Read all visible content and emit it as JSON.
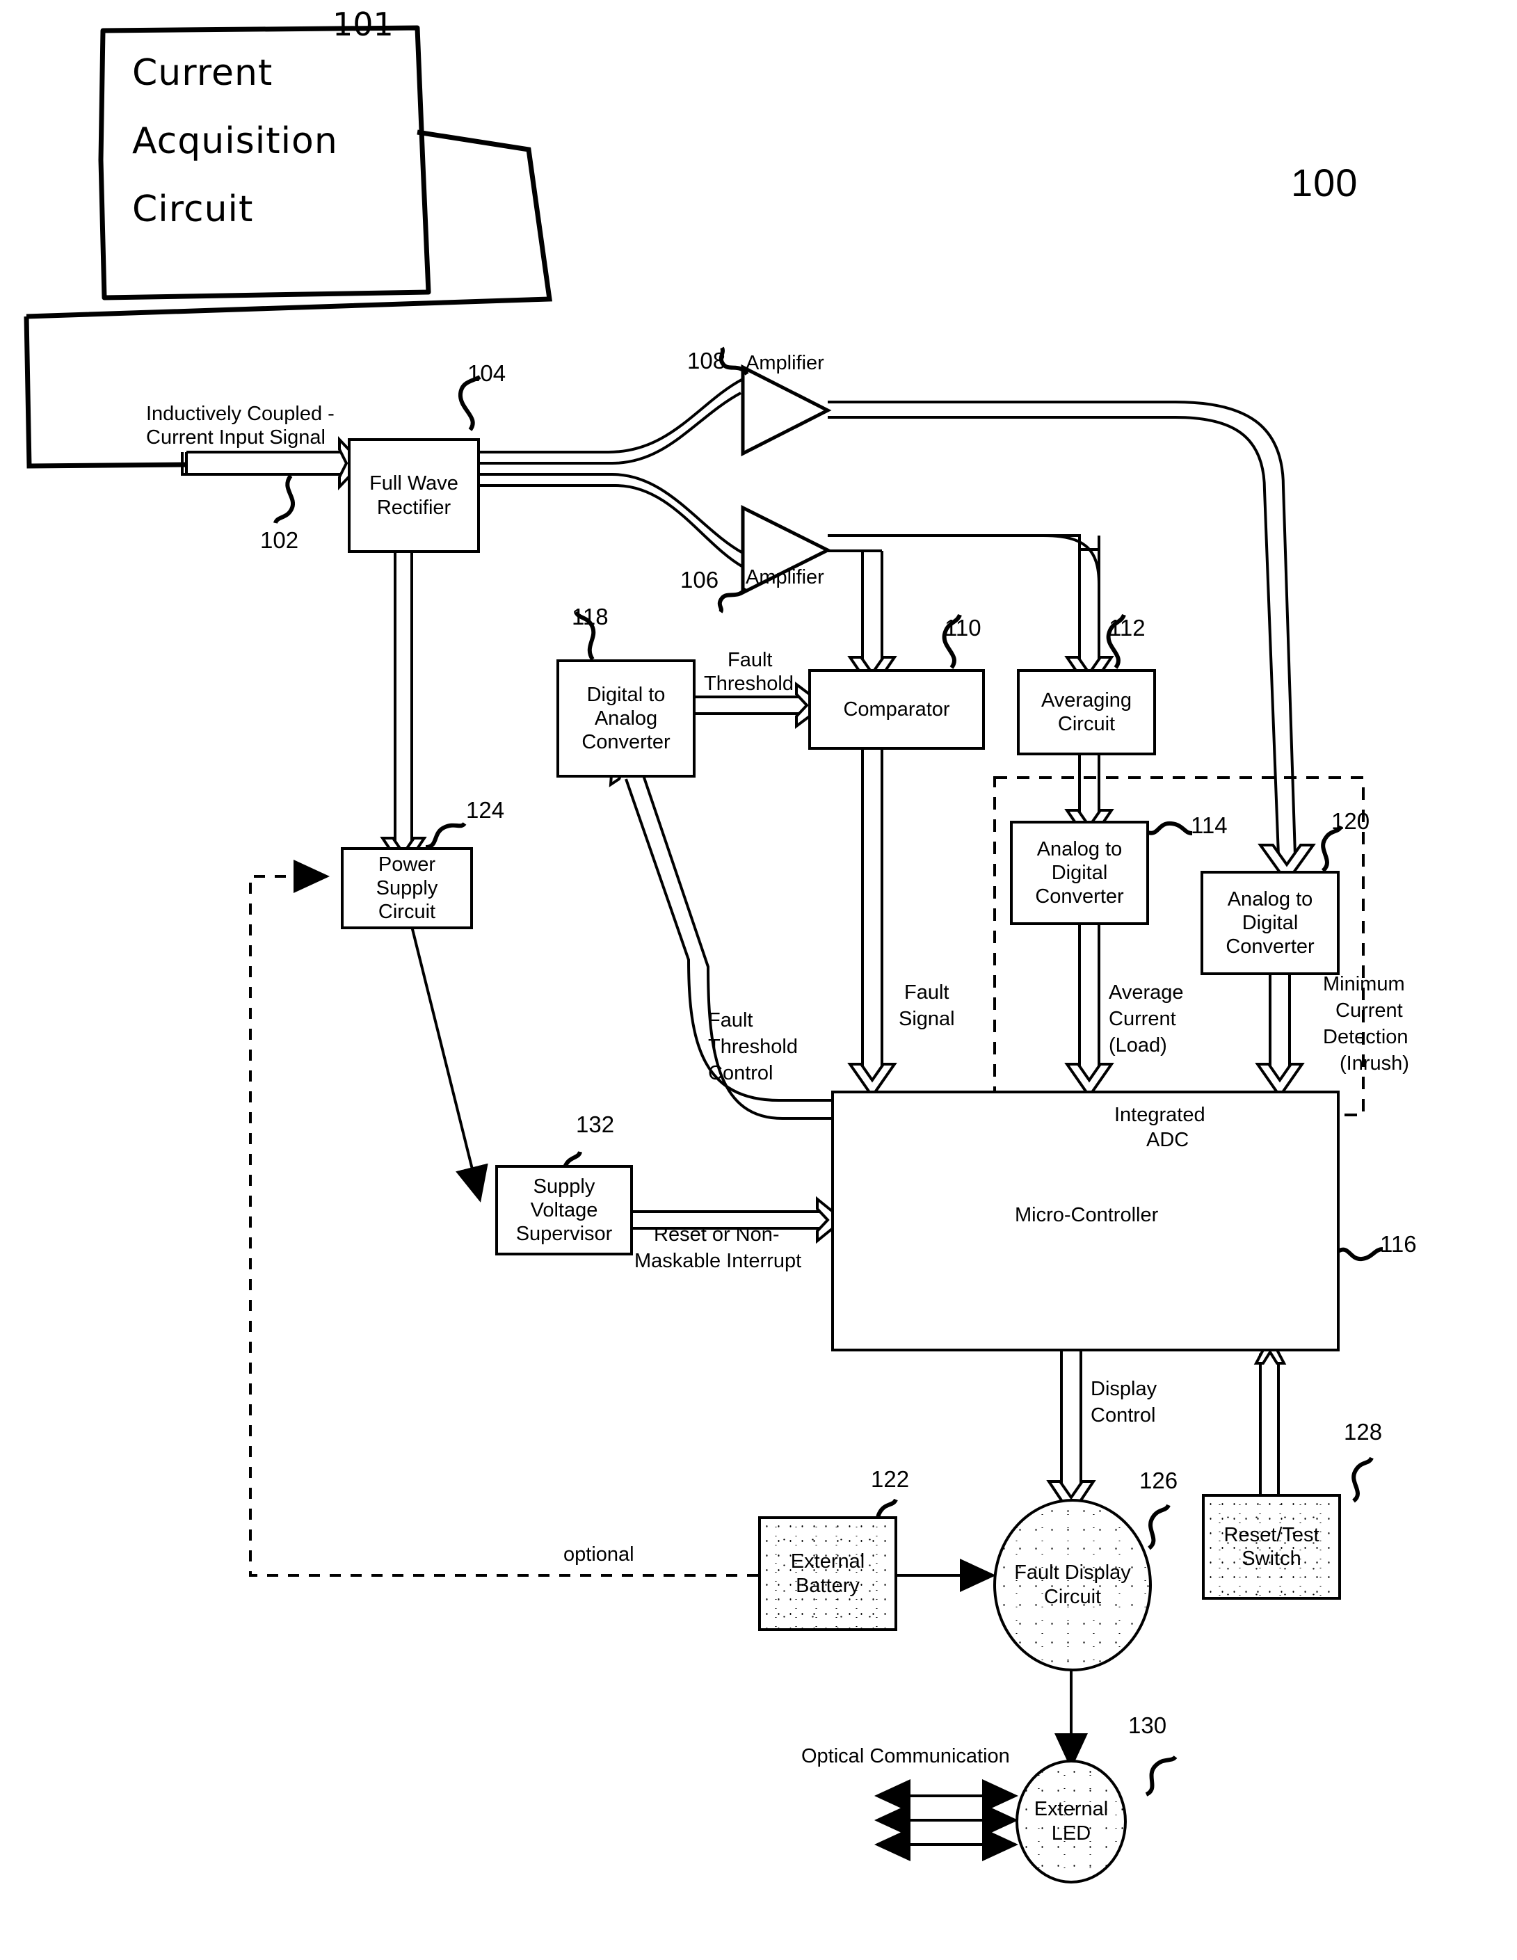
{
  "figure": {
    "number": "100",
    "hand_annotation": {
      "label": "101",
      "line1": "Current",
      "line2": "Acquisition",
      "line3": "Circuit"
    }
  },
  "blocks": [
    {
      "id": "full-wave-rectifier",
      "ref": "104",
      "line1": "Full Wave",
      "line2": "Rectifier",
      "line3": ""
    },
    {
      "id": "amplifier-108",
      "ref": "108",
      "line1": "Amplifier",
      "line2": "",
      "line3": ""
    },
    {
      "id": "amplifier-106",
      "ref": "106",
      "line1": "Amplifier",
      "line2": "",
      "line3": ""
    },
    {
      "id": "digital-to-analog-converter",
      "ref": "118",
      "line1": "Digital to",
      "line2": "Analog",
      "line3": "Converter"
    },
    {
      "id": "comparator",
      "ref": "110",
      "line1": "Comparator",
      "line2": "",
      "line3": ""
    },
    {
      "id": "averaging-circuit",
      "ref": "112",
      "line1": "Averaging",
      "line2": "Circuit",
      "line3": ""
    },
    {
      "id": "analog-to-digital-converter-114",
      "ref": "114",
      "line1": "Analog to",
      "line2": "Digital",
      "line3": "Converter"
    },
    {
      "id": "analog-to-digital-converter-120",
      "ref": "120",
      "line1": "Analog to",
      "line2": "Digital",
      "line3": "Converter"
    },
    {
      "id": "power-supply-circuit",
      "ref": "124",
      "line1": "Power",
      "line2": "Supply",
      "line3": "Circuit"
    },
    {
      "id": "supply-voltage-supervisor",
      "ref": "132",
      "line1": "Supply",
      "line2": "Voltage",
      "line3": "Supervisor"
    },
    {
      "id": "micro-controller",
      "ref": "116",
      "line1": "Micro-Controller",
      "line2": "",
      "line3": ""
    },
    {
      "id": "external-battery",
      "ref": "122",
      "line1": "External",
      "line2": "Battery",
      "line3": ""
    },
    {
      "id": "fault-display-circuit",
      "ref": "126",
      "line1": "Fault Display",
      "line2": "Circuit",
      "line3": ""
    },
    {
      "id": "reset-test-switch",
      "ref": "128",
      "line1": "Reset/Test",
      "line2": "Switch",
      "line3": ""
    },
    {
      "id": "external-led",
      "ref": "130",
      "line1": "External",
      "line2": "LED",
      "line3": ""
    }
  ],
  "signal_labels": {
    "input_signal_l1": "Inductively Coupled -",
    "input_signal_l2": "Current Input Signal",
    "input_signal_ref": "102",
    "fault_threshold_l1": "Fault",
    "fault_threshold_l2": "Threshold",
    "fault_threshold_control_l1": "Fault",
    "fault_threshold_control_l2": "Threshold",
    "fault_threshold_control_l3": "Control",
    "fault_signal_l1": "Fault",
    "fault_signal_l2": "Signal",
    "average_current_l1": "Average",
    "average_current_l2": "Current",
    "average_current_l3": "(Load)",
    "minimum_current_l1": "Minimum",
    "minimum_current_l2": "Current",
    "minimum_current_l3": "Detection",
    "minimum_current_l4": "(Inrush)",
    "integrated_adc_l1": "Integrated",
    "integrated_adc_l2": "ADC",
    "reset_nmi_l1": "Reset or Non-",
    "reset_nmi_l2": "Maskable Interrupt",
    "display_control_l1": "Display",
    "display_control_l2": "Control",
    "optional": "optional",
    "optical_communication": "Optical Communication"
  },
  "colors": {
    "ink": "#000000",
    "paper": "#ffffff"
  }
}
